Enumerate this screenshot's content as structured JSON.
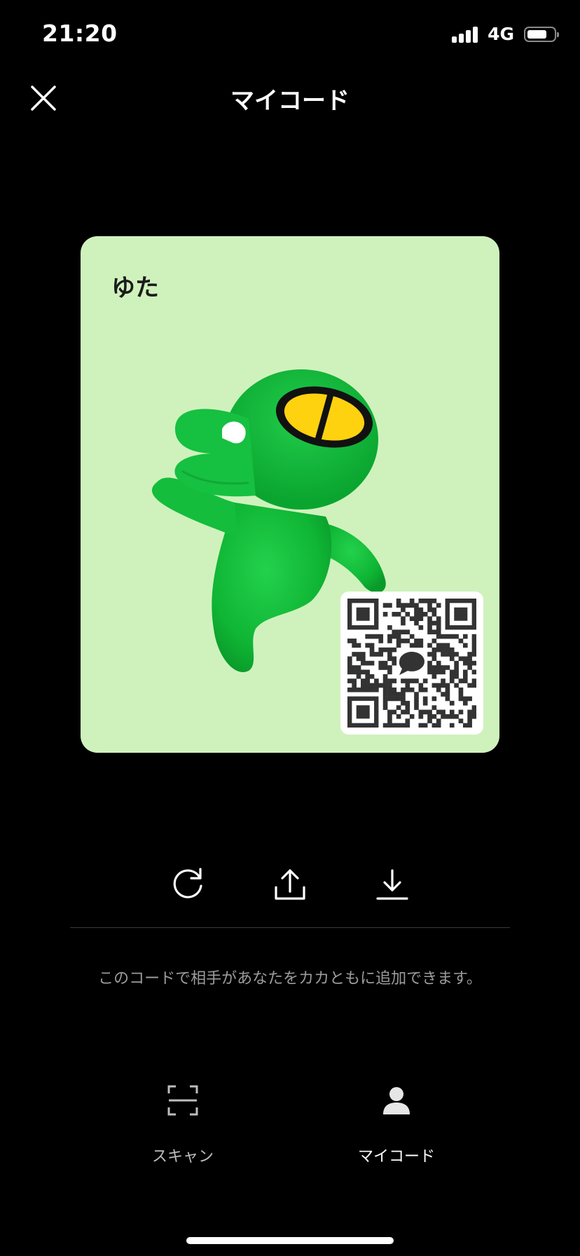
{
  "status_bar": {
    "time": "21:20",
    "network": "4G",
    "battery_level": 0.75,
    "signal_bars": 4
  },
  "nav": {
    "title": "マイコード",
    "close_icon": "close-icon"
  },
  "card": {
    "background_color": "#cff2bd",
    "name": "ゆた",
    "qr_icon": "chat-bubble-icon"
  },
  "actions": [
    {
      "icon": "refresh-icon"
    },
    {
      "icon": "share-icon"
    },
    {
      "icon": "download-icon"
    }
  ],
  "hint_text": "このコードで相手があなたをカカともに追加できます。",
  "tabs": [
    {
      "label": "スキャン",
      "icon": "scan-icon",
      "active": false
    },
    {
      "label": "マイコード",
      "icon": "person-icon",
      "active": true
    }
  ],
  "colors": {
    "background": "#000000",
    "inactive_text": "#bdbdbd",
    "active_text": "#ffffff"
  }
}
